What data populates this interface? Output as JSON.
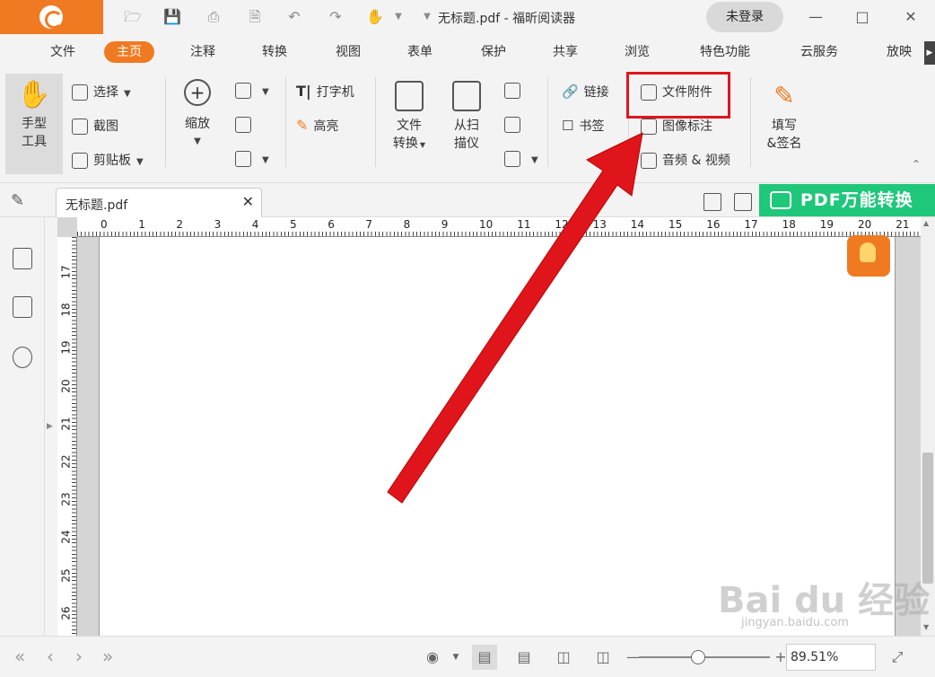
{
  "titlebar": {
    "title": "无标题.pdf - 福昕阅读器",
    "login": "未登录",
    "quick_icons": [
      "folder-open-icon",
      "save-icon",
      "print-icon",
      "new-file-icon",
      "undo-icon",
      "redo-icon",
      "hand-icon"
    ]
  },
  "menu": {
    "tabs": [
      "文件",
      "主页",
      "注释",
      "转换",
      "视图",
      "表单",
      "保护",
      "共享",
      "浏览",
      "特色功能",
      "云服务",
      "放映"
    ],
    "active": "主页"
  },
  "ribbon": {
    "hand_tool_line1": "手型",
    "hand_tool_line2": "工具",
    "select": "选择",
    "screenshot": "截图",
    "clipboard": "剪贴板",
    "zoom": "缩放",
    "typewriter": "打字机",
    "highlight": "高亮",
    "file_convert_line1": "文件",
    "file_convert_line2": "转换",
    "from_scanner_line1": "从扫",
    "from_scanner_line2": "描仪",
    "link": "链接",
    "bookmark": "书签",
    "file_attachment": "文件附件",
    "image_annotation": "图像标注",
    "audio_video": "音频 & 视频",
    "fill_sign_line1": "填写",
    "fill_sign_line2": "&签名"
  },
  "document": {
    "tab_label": "无标题.pdf",
    "pdf_convert": "PDF万能转换"
  },
  "ruler": {
    "h_numbers": [
      "0",
      "1",
      "2",
      "3",
      "4",
      "5",
      "6",
      "7",
      "8",
      "9",
      "10",
      "11",
      "12",
      "13",
      "14",
      "15",
      "16",
      "17",
      "18",
      "19",
      "20",
      "21"
    ],
    "v_numbers": [
      "17",
      "18",
      "19",
      "20",
      "21",
      "22",
      "23",
      "24",
      "25",
      "26"
    ]
  },
  "status": {
    "zoom": "89.51%"
  },
  "watermark": {
    "text": "Bai du 经验",
    "sub": "jingyan.baidu.com"
  },
  "colors": {
    "accent": "#f07a22",
    "highlight_box": "#e0151b",
    "convert_green": "#1fc77a"
  }
}
